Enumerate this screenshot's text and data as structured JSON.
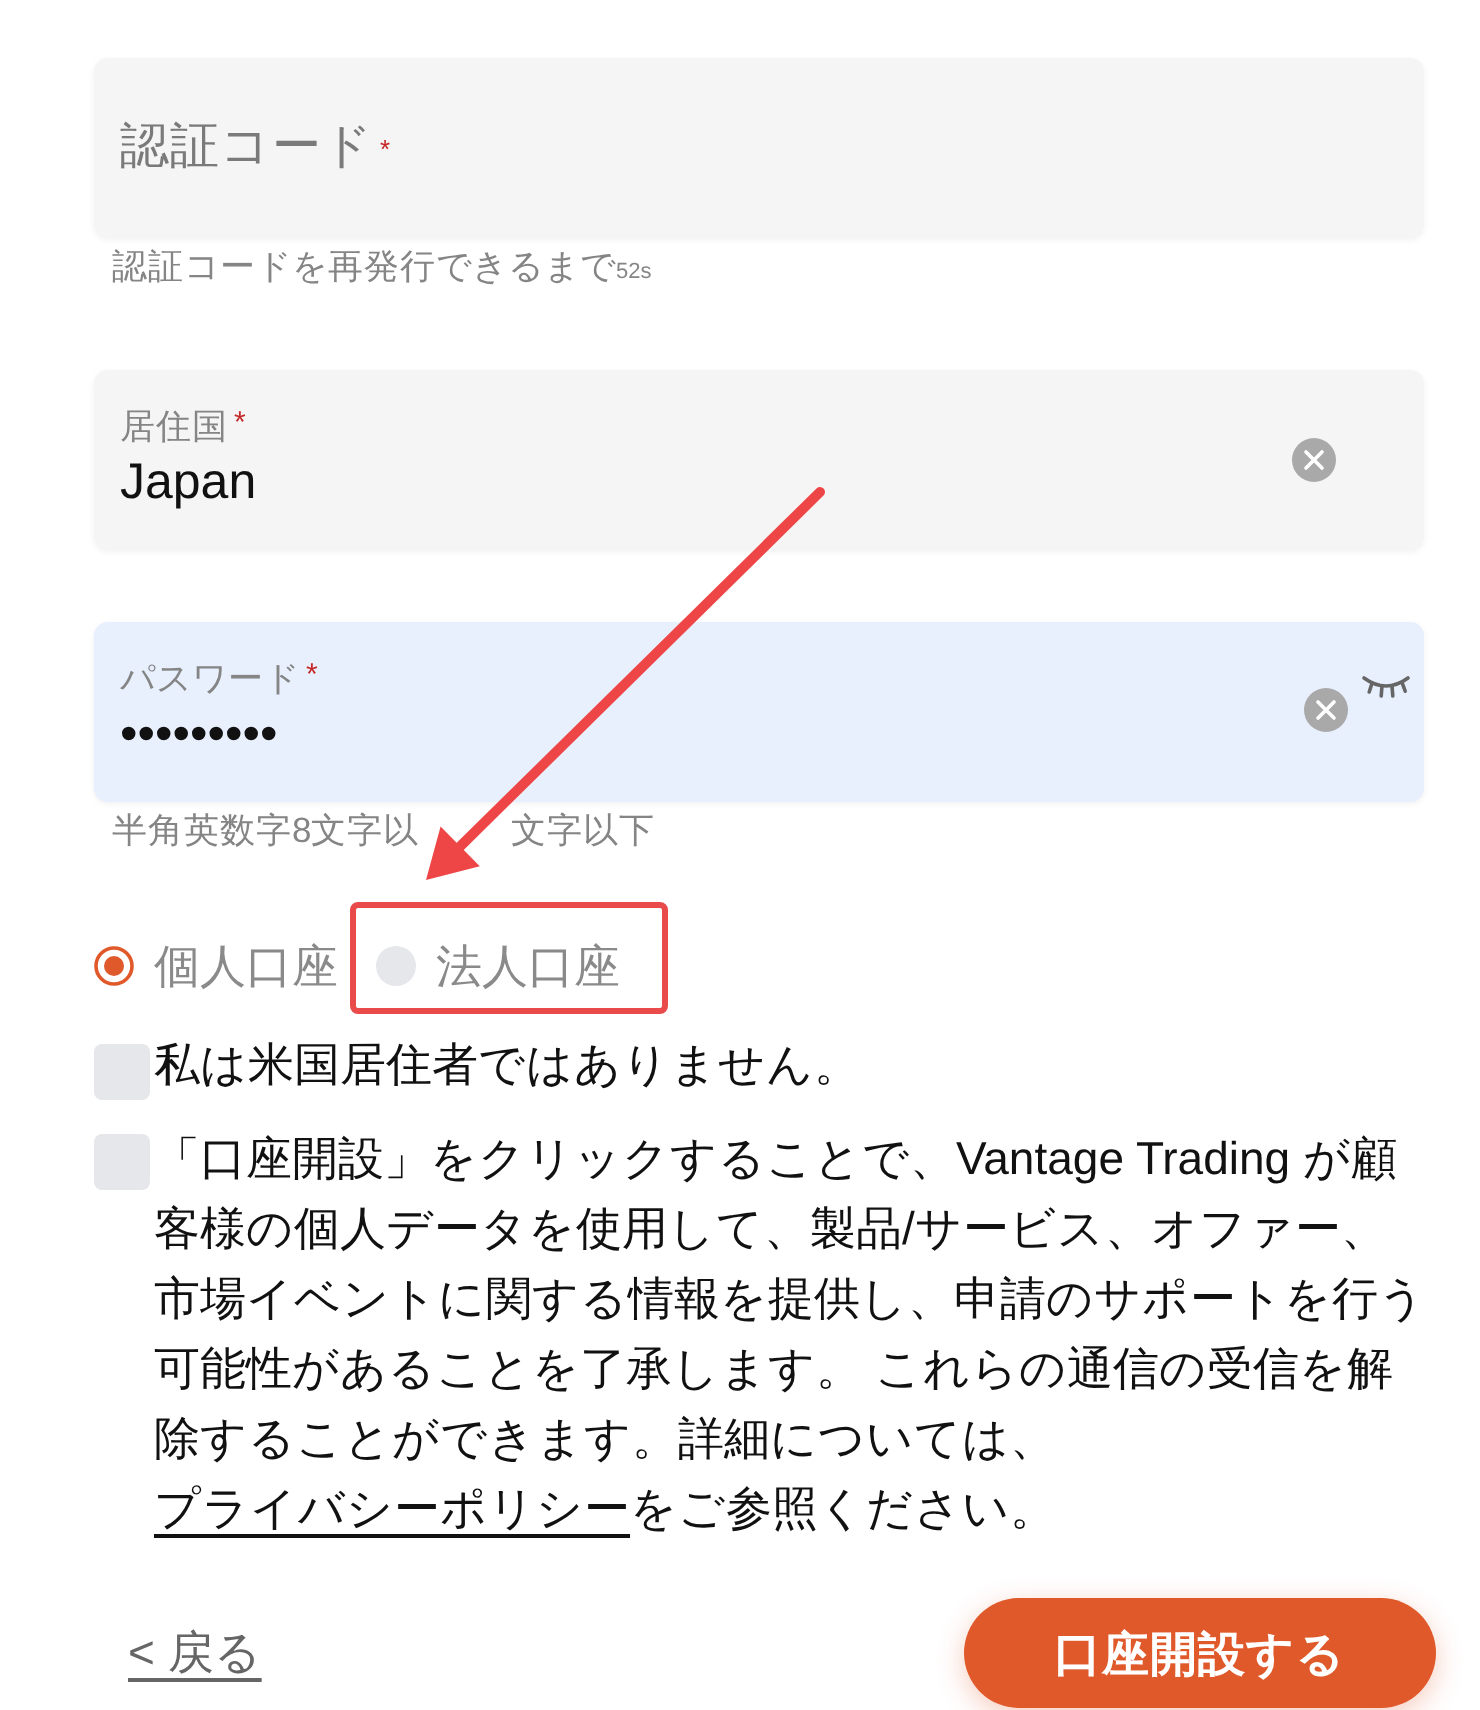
{
  "fields": [
    {
      "kind": "code",
      "label": "認証コード",
      "required_mark": "*",
      "autofilled": false,
      "helper": "認証コードを再発行できるまで",
      "countdown": "52s"
    },
    {
      "kind": "select",
      "label": "居住国",
      "required_mark": "*",
      "value": "Japan",
      "autofilled": false
    },
    {
      "kind": "password",
      "label": "パスワード",
      "required_mark": "*",
      "value": "•••••••••",
      "autofilled": true,
      "hint_parts": [
        "半角英数字8文字以",
        "文字以下"
      ]
    }
  ],
  "account_types": [
    {
      "label": "個人口座",
      "selected": true,
      "highlighted": false
    },
    {
      "label": "法人口座",
      "selected": false,
      "highlighted": true
    }
  ],
  "agreements": [
    {
      "kind": "plain",
      "text": "私は米国居住者ではありません。",
      "checked": false
    },
    {
      "kind": "consent",
      "text": "「口座開設」をクリックすることで、Vantage Trading が顧客様の個人データを使用して、製品/サービス、オファー、市場イベントに関する情報を提供し、申請のサポートを行う可能性があることを了承します。 これらの通信の受信を解除することができます。詳細については、",
      "link": "プライバシーポリシー",
      "text_after": "をご参照ください。",
      "checked": false
    }
  ],
  "back_link": "< 戻る",
  "submit_button": "口座開設する"
}
